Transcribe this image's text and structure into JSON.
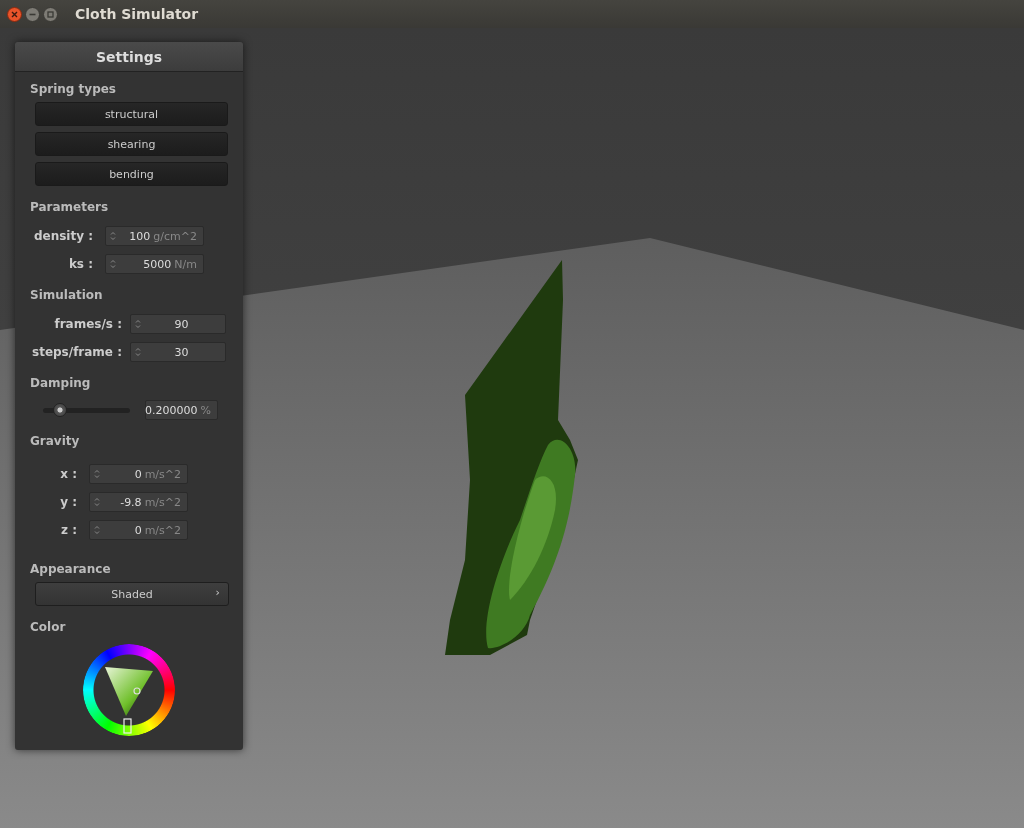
{
  "window": {
    "title": "Cloth Simulator"
  },
  "settings": {
    "title": "Settings"
  },
  "spring_types": {
    "label": "Spring types",
    "buttons": [
      "structural",
      "shearing",
      "bending"
    ]
  },
  "parameters": {
    "label": "Parameters",
    "fields": [
      {
        "label": "density :",
        "value": "100",
        "unit": "g/cm^2"
      },
      {
        "label": "ks :",
        "value": "5000",
        "unit": "N/m"
      }
    ]
  },
  "simulation": {
    "label": "Simulation",
    "fields": [
      {
        "label": "frames/s :",
        "value": "90"
      },
      {
        "label": "steps/frame :",
        "value": "30"
      }
    ]
  },
  "damping": {
    "label": "Damping",
    "level": 0.2,
    "value": "0.200000",
    "unit": "%"
  },
  "gravity": {
    "label": "Gravity",
    "fields": [
      {
        "label": "x :",
        "value": "0",
        "unit": "m/s^2"
      },
      {
        "label": "y :",
        "value": "-9.8",
        "unit": "m/s^2"
      },
      {
        "label": "z :",
        "value": "0",
        "unit": "m/s^2"
      }
    ]
  },
  "appearance": {
    "label": "Appearance",
    "value": "Shaded",
    "arrow": "›"
  },
  "color": {
    "label": "Color"
  }
}
